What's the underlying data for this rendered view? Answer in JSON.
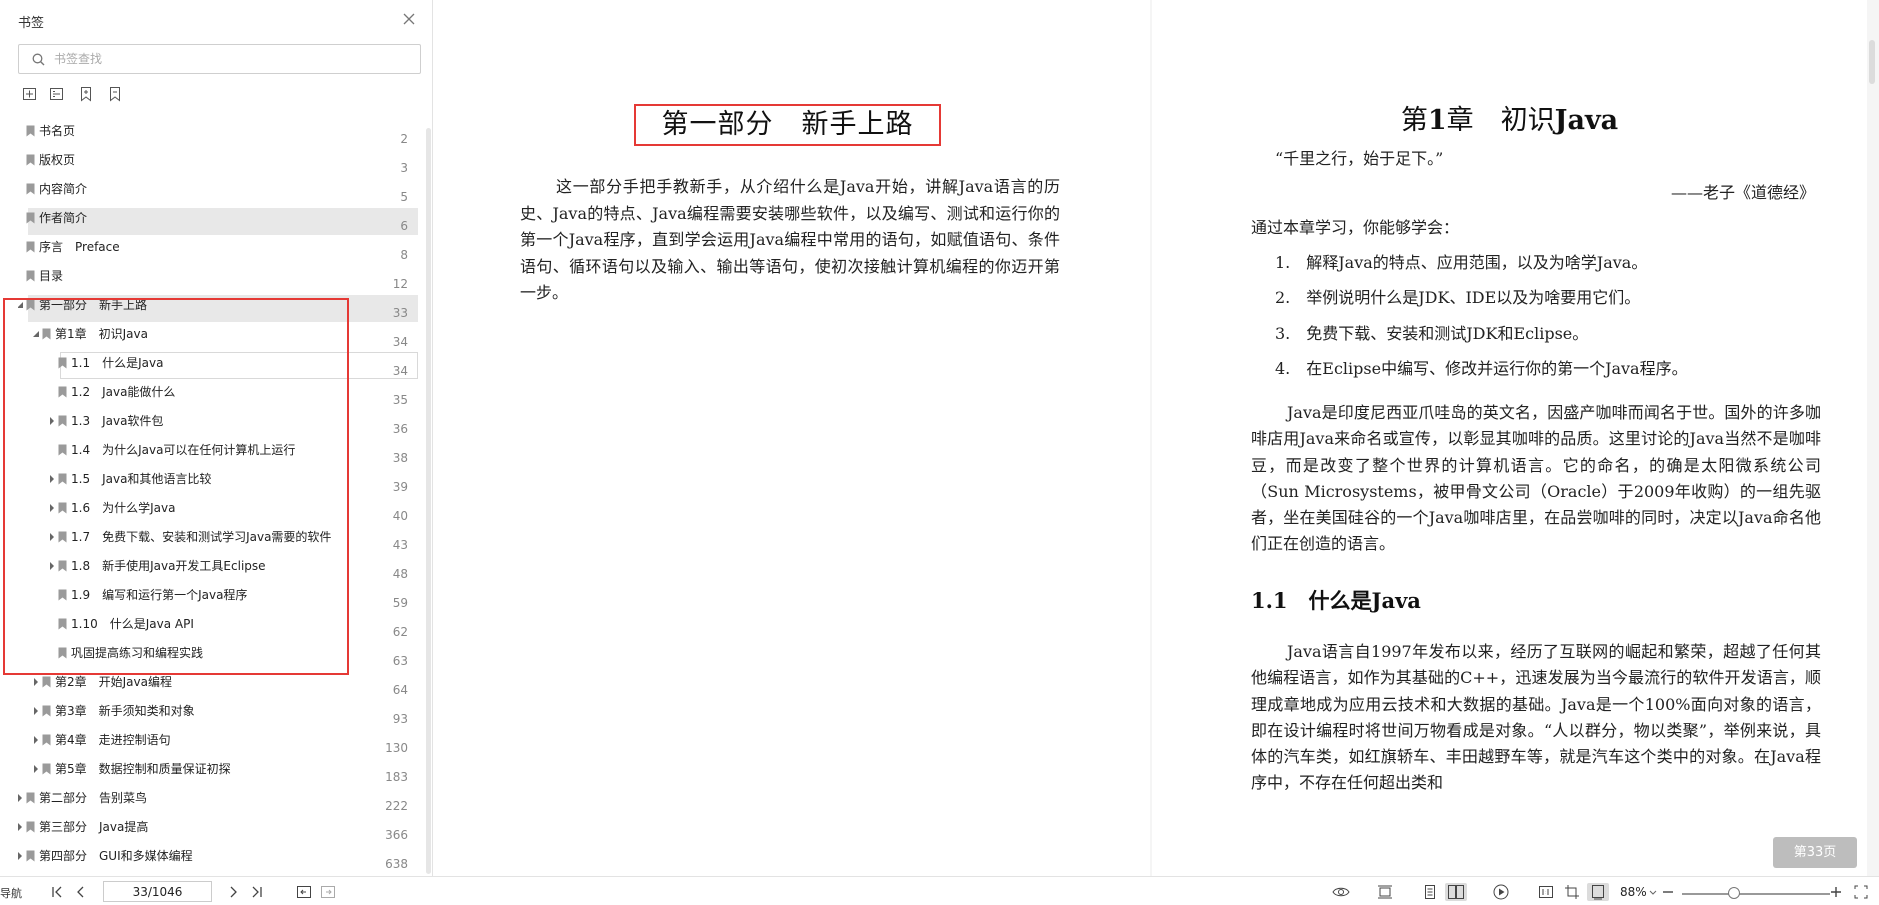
{
  "sidebar": {
    "title": "书签",
    "search_placeholder": "书签查找",
    "tree": [
      {
        "label": "书名页",
        "page": "2",
        "level": 0,
        "arrow": "none"
      },
      {
        "label": "版权页",
        "page": "3",
        "level": 0,
        "arrow": "none"
      },
      {
        "label": "内容简介",
        "page": "5",
        "level": 0,
        "arrow": "none"
      },
      {
        "label": "作者简介",
        "page": "6",
        "level": 0,
        "arrow": "none",
        "state": "hover"
      },
      {
        "label": "序言　Preface",
        "page": "8",
        "level": 0,
        "arrow": "none"
      },
      {
        "label": "目录",
        "page": "12",
        "level": 0,
        "arrow": "none"
      },
      {
        "label": "第一部分　新手上路",
        "page": "33",
        "level": 0,
        "arrow": "expanded",
        "state": "selected"
      },
      {
        "label": "第1章　初识Java",
        "page": "34",
        "level": 1,
        "arrow": "expanded"
      },
      {
        "label": "1.1　什么是Java",
        "page": "34",
        "level": 2,
        "arrow": "none",
        "state": "outlined"
      },
      {
        "label": "1.2　Java能做什么",
        "page": "35",
        "level": 2,
        "arrow": "none"
      },
      {
        "label": "1.3　Java软件包",
        "page": "36",
        "level": 2,
        "arrow": "collapsed"
      },
      {
        "label": "1.4　为什么Java可以在任何计算机上运行",
        "page": "38",
        "level": 2,
        "arrow": "none"
      },
      {
        "label": "1.5　Java和其他语言比较",
        "page": "39",
        "level": 2,
        "arrow": "collapsed"
      },
      {
        "label": "1.6　为什么学Java",
        "page": "40",
        "level": 2,
        "arrow": "collapsed"
      },
      {
        "label": "1.7　免费下载、安装和测试学习Java需要的软件",
        "page": "43",
        "level": 2,
        "arrow": "collapsed"
      },
      {
        "label": "1.8　新手使用Java开发工具Eclipse",
        "page": "48",
        "level": 2,
        "arrow": "collapsed"
      },
      {
        "label": "1.9　编写和运行第一个Java程序",
        "page": "59",
        "level": 2,
        "arrow": "none"
      },
      {
        "label": "1.10　什么是Java API",
        "page": "62",
        "level": 2,
        "arrow": "none"
      },
      {
        "label": "巩固提高练习和编程实践",
        "page": "63",
        "level": 2,
        "arrow": "none"
      },
      {
        "label": "第2章　开始Java编程",
        "page": "64",
        "level": 1,
        "arrow": "collapsed"
      },
      {
        "label": "第3章　新手须知类和对象",
        "page": "93",
        "level": 1,
        "arrow": "collapsed"
      },
      {
        "label": "第4章　走进控制语句",
        "page": "130",
        "level": 1,
        "arrow": "collapsed"
      },
      {
        "label": "第5章　数据控制和质量保证初探",
        "page": "183",
        "level": 1,
        "arrow": "collapsed"
      },
      {
        "label": "第二部分　告别菜鸟",
        "page": "222",
        "level": 0,
        "arrow": "collapsed"
      },
      {
        "label": "第三部分　Java提高",
        "page": "366",
        "level": 0,
        "arrow": "collapsed"
      },
      {
        "label": "第四部分　GUI和多媒体编程",
        "page": "638",
        "level": 0,
        "arrow": "collapsed"
      }
    ]
  },
  "left_page": {
    "part_title": "第一部分　新手上路",
    "intro": "这一部分手把手教新手，从介绍什么是Java开始，讲解Java语言的历史、Java的特点、Java编程需要安装哪些软件，以及编写、测试和运行你的第一个Java程序，直到学会运用Java编程中常用的语句，如赋值语句、条件语句、循环语句以及输入、输出等语句，使初次接触计算机编程的你迈开第一步。"
  },
  "right_page": {
    "chapter_prefix": "第",
    "chapter_num": "1",
    "chapter_suffix": "章",
    "chapter_name": "初识",
    "chapter_name_bold": "Java",
    "quote": "“千里之行，始于足下。”",
    "quote_source": "——老子《道德经》",
    "learn_intro": "通过本章学习，你能够学会：",
    "objectives": [
      "1.　解释Java的特点、应用范围，以及为啥学Java。",
      "2.　举例说明什么是JDK、IDE以及为啥要用它们。",
      "3.　免费下载、安装和测试JDK和Eclipse。",
      "4.　在Eclipse中编写、修改并运行你的第一个Java程序。"
    ],
    "para1": "Java是印度尼西亚爪哇岛的英文名，因盛产咖啡而闻名于世。国外的许多咖啡店用Java来命名或宣传，以彰显其咖啡的品质。这里讨论的Java当然不是咖啡豆，而是改变了整个世界的计算机语言。它的命名，的确是太阳微系统公司（Sun Microsystems，被甲骨文公司（Oracle）于2009年收购）的一组先驱者，坐在美国硅谷的一个Java咖啡店里，在品尝咖啡的同时，决定以Java命名他们正在创造的语言。",
    "section_num": "1.1",
    "section_title": "什么是Java",
    "para2": "Java语言自1997年发布以来，经历了互联网的崛起和繁荣，超越了任何其他编程语言，如作为其基础的C++，迅速发展为当今最流行的软件开发语言，顺理成章地成为应用云技术和大数据的基础。Java是一个100%面向对象的语言，即在设计编程时将世间万物看成是对象。“人以群分，物以类聚”，举例来说，具体的汽车类，如红旗轿车、丰田越野车等，就是汽车这个类中的对象。在Java程序中，不存在任何超出类和"
  },
  "page_badge": "第33页",
  "statusbar": {
    "nav_label": "导航",
    "page_value": "33/1046",
    "zoom": "88%",
    "zoom_fraction": 0.35
  }
}
